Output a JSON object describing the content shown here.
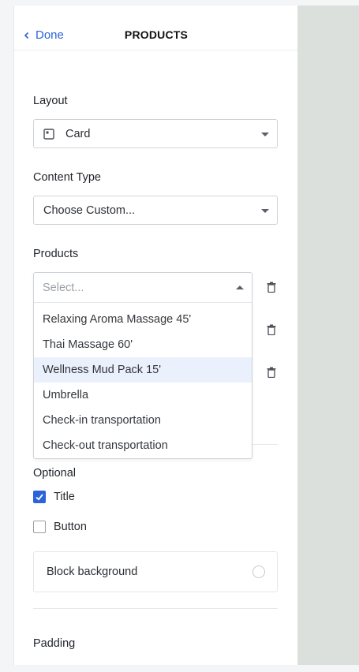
{
  "header": {
    "back_label": "Done",
    "title": "PRODUCTS"
  },
  "layout": {
    "label": "Layout",
    "value": "Card",
    "icon": "card-layout-icon"
  },
  "content_type": {
    "label": "Content Type",
    "value": "Choose Custom..."
  },
  "products": {
    "label": "Products",
    "placeholder": "Select...",
    "options": [
      "Relaxing Aroma Massage 45'",
      "Thai Massage 60'",
      "Wellness Mud Pack 15'",
      "Umbrella",
      "Check-in transportation",
      "Check-out transportation"
    ],
    "highlighted_option": "Wellness Mud Pack 15'"
  },
  "optional": {
    "label": "Optional",
    "title_label": "Title",
    "title_checked": true,
    "button_label": "Button",
    "button_checked": false
  },
  "block_background": {
    "label": "Block background"
  },
  "padding": {
    "label": "Padding"
  },
  "colors": {
    "accent": "#2b63d9",
    "preview_bg": "#dbe0dd",
    "highlight": "#eaf0fc"
  }
}
